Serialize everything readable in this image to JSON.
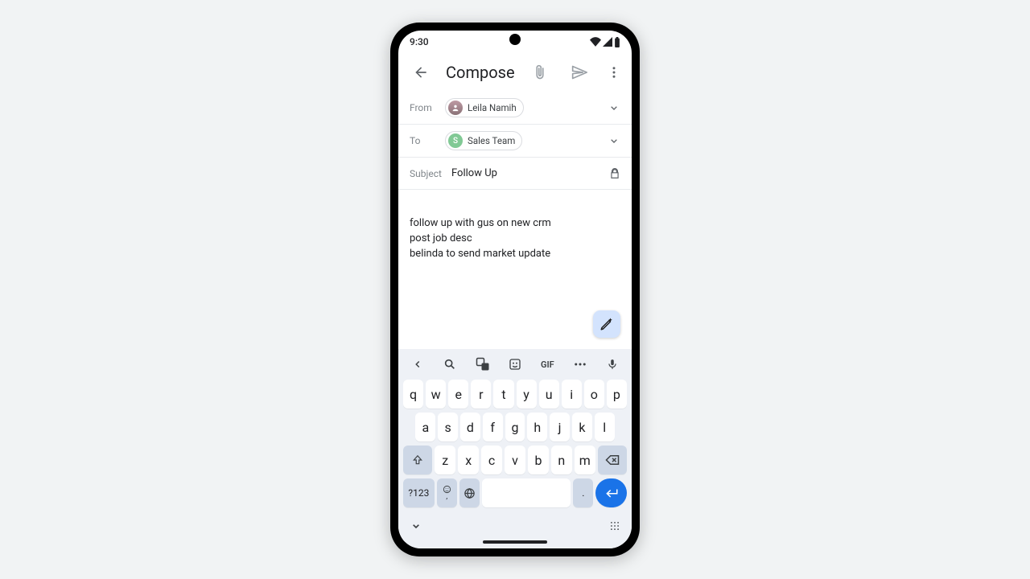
{
  "status": {
    "time": "9:30"
  },
  "appbar": {
    "title": "Compose"
  },
  "fields": {
    "from_label": "From",
    "from_name": "Leila Namih",
    "to_label": "To",
    "to_name": "Sales Team",
    "to_initial": "S",
    "subject_label": "Subject",
    "subject_value": "Follow Up"
  },
  "body": "follow up with gus on new crm\npost job desc\nbelinda to send market update",
  "keyboard": {
    "gif_label": "GIF",
    "sym_label": "?123",
    "comma": ",",
    "period": ".",
    "row1": [
      "q",
      "w",
      "e",
      "r",
      "t",
      "y",
      "u",
      "i",
      "o",
      "p"
    ],
    "row2": [
      "a",
      "s",
      "d",
      "f",
      "g",
      "h",
      "j",
      "k",
      "l"
    ],
    "row3": [
      "z",
      "x",
      "c",
      "v",
      "b",
      "n",
      "m"
    ]
  }
}
